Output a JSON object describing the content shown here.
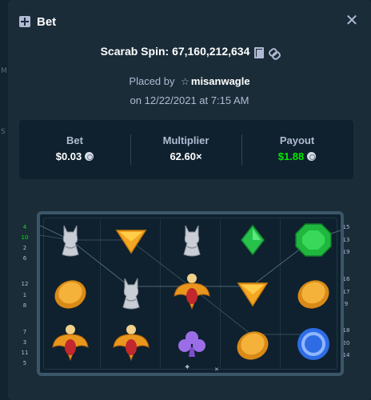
{
  "modal": {
    "title": "Bet",
    "spin_label": "Scarab Spin: 67,160,212,634",
    "placed_by_prefix": "Placed by",
    "username": "misanwagle",
    "date": "on 12/22/2021 at 7:15 AM"
  },
  "stats": {
    "bet_label": "Bet",
    "bet_value": "$0.03",
    "multiplier_label": "Multiplier",
    "multiplier_value": "62.60×",
    "payout_label": "Payout",
    "payout_value": "$1.88",
    "payout_color": "#00e701"
  },
  "board": {
    "left_lines": [
      "4",
      "10",
      "2",
      "6",
      "12",
      "1",
      "8",
      "7",
      "3",
      "11",
      "5"
    ],
    "right_lines": [
      "15",
      "13",
      "19",
      "16",
      "17",
      "9",
      "18",
      "20",
      "14"
    ],
    "active_lines": [
      "4",
      "10"
    ],
    "grid": [
      [
        "cat",
        "gold-triangle",
        "cat",
        "green-diamond",
        "emerald"
      ],
      [
        "gold-coin",
        "cat",
        "scarab",
        "gold-triangle",
        "gold-coin"
      ],
      [
        "scarab",
        "scarab",
        "purple-club",
        "gold-coin",
        "blue-ring"
      ]
    ]
  },
  "colors": {
    "background": "#1a2c38",
    "panel": "#0f212e",
    "accent_green": "#00e701",
    "muted_text": "#b1bad3"
  }
}
